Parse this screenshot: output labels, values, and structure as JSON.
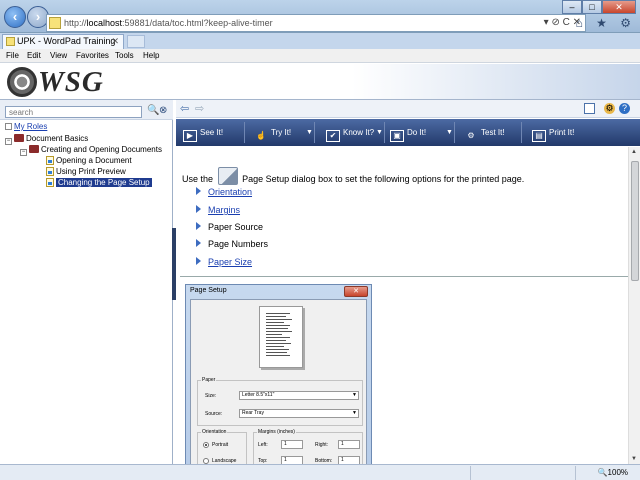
{
  "browser": {
    "url_prefix": "http://",
    "url_host": "localhost",
    "url_rest": ":59881/data/toc.html?keep-alive-timer",
    "addr_actions": "▾ ⊘ C ✕",
    "minimize": "–",
    "maximize": "□",
    "close": "✕",
    "tab_label": "UPK - WordPad Training",
    "tab_close": "✕",
    "menu": [
      "File",
      "Edit",
      "View",
      "Favorites",
      "Tools",
      "Help"
    ],
    "right_icons": "⌂ ★ ⚙",
    "zoom": "🔍100%"
  },
  "banner": {
    "logo_text": "WSG"
  },
  "sidebar": {
    "search_placeholder": "search",
    "my_roles": "My Roles",
    "tree": [
      {
        "label": "Document Basics"
      },
      {
        "label": "Creating and Opening Documents"
      },
      {
        "label": "Opening a Document"
      },
      {
        "label": "Using Print Preview"
      },
      {
        "label": "Changing the Page Setup",
        "selected": true
      }
    ]
  },
  "modes": [
    {
      "label": "See It!",
      "icon": "▶"
    },
    {
      "label": "Try It!",
      "icon": "☝"
    },
    {
      "label": "Know It?",
      "icon": "✔"
    },
    {
      "label": "Do It!",
      "icon": "▣"
    },
    {
      "label": "Test It!",
      "icon": "⚙"
    },
    {
      "label": "Print It!",
      "icon": "▤"
    }
  ],
  "content": {
    "intro_before": "Use the",
    "intro_after": "Page Setup dialog box to set the following options for the printed page.",
    "options": [
      {
        "label": "Orientation",
        "link": true
      },
      {
        "label": "Margins",
        "link": true
      },
      {
        "label": "Paper Source",
        "link": false
      },
      {
        "label": "Page Numbers",
        "link": false
      },
      {
        "label": "Paper Size",
        "link": true
      }
    ]
  },
  "dialog": {
    "title": "Page Setup",
    "close": "✕",
    "paper_group": "Paper",
    "size_label": "Size:",
    "size_value": "Letter 8.5\"x11\"",
    "source_label": "Source:",
    "source_value": "Rear Tray",
    "orientation_group": "Orientation",
    "portrait": "Portrait",
    "landscape": "Landscape",
    "margins_group": "Margins (inches)",
    "left_label": "Left:",
    "left_value": "1",
    "right_label": "Right:",
    "right_value": "1",
    "top_label": "Top:",
    "top_value": "1",
    "bottom_label": "Bottom:",
    "bottom_value": "1"
  }
}
